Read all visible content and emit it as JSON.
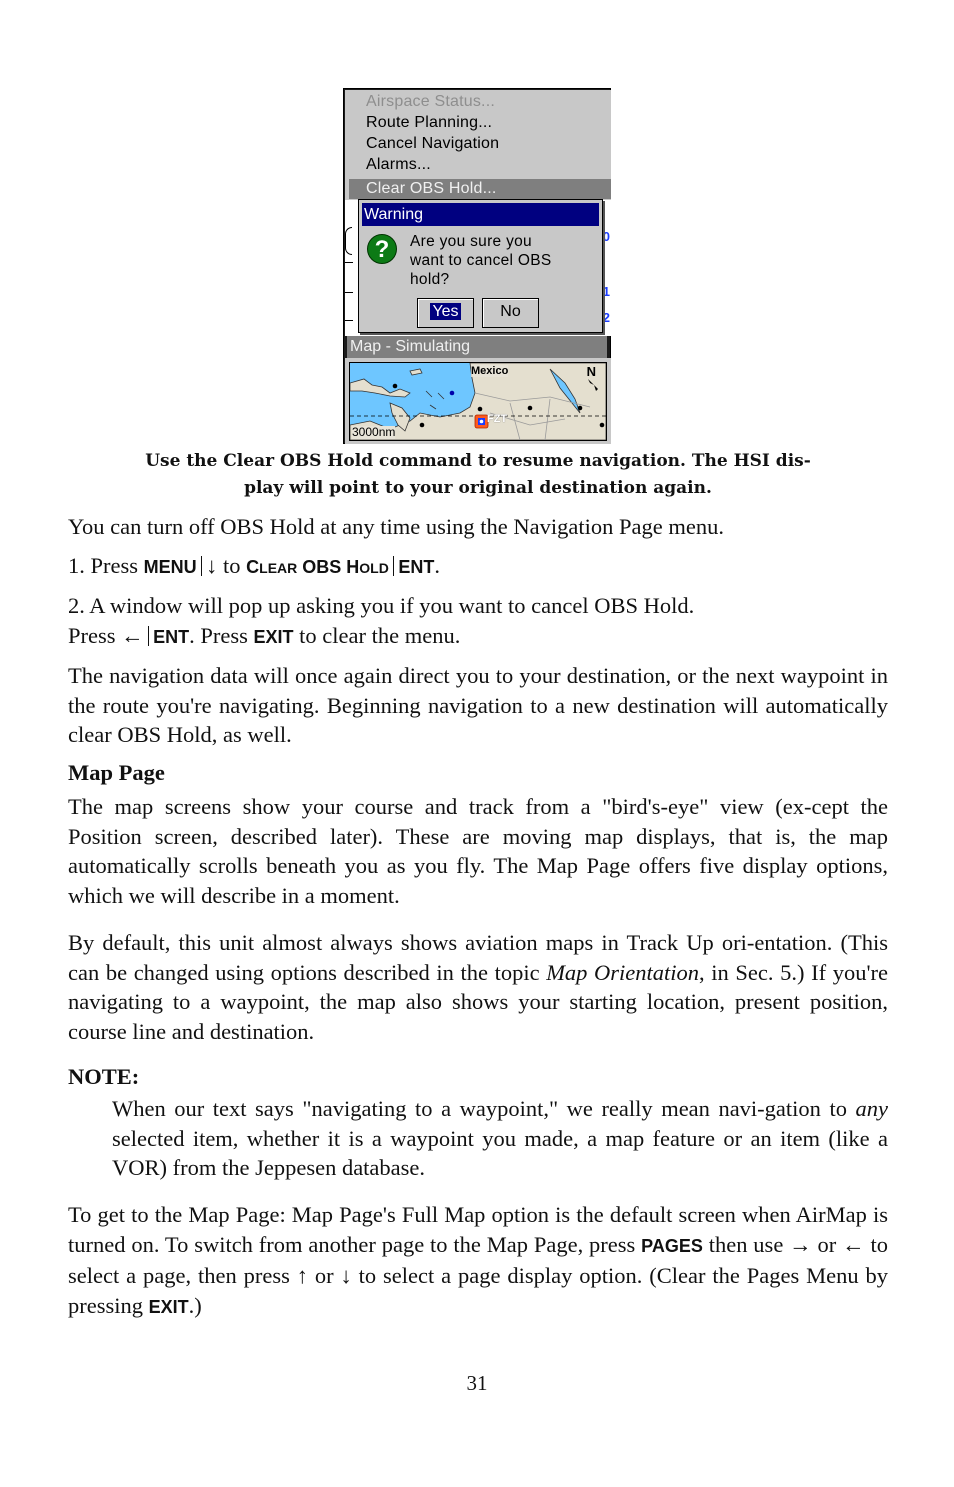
{
  "device": {
    "menu_items": [
      {
        "label": "Airspace Status...",
        "state": "disabled"
      },
      {
        "label": "Route Planning...",
        "state": "normal"
      },
      {
        "label": "Cancel Navigation",
        "state": "normal"
      },
      {
        "label": "Alarms...",
        "state": "normal"
      },
      {
        "label": "Clear OBS Hold...",
        "state": "highlighted"
      }
    ],
    "hsi_numbers": [
      "0",
      "1",
      "2"
    ],
    "warning": {
      "title": "Warning",
      "icon": "question-icon",
      "icon_glyph": "?",
      "message": "Are you sure you\nwant to cancel OBS\nhold?",
      "yes_label": "Yes",
      "no_label": "No"
    },
    "map": {
      "title": "Map - Simulating",
      "region_label": "Mexico",
      "north_label": "N",
      "waypoint_label": "FZT",
      "scale_label": "3000nm",
      "colors": {
        "water": "#6ec6ff",
        "land": "#e4dfcf",
        "highlight": "#000080",
        "waypoint": "#ff5a1f"
      }
    }
  },
  "caption": {
    "line1": "Use the Clear OBS Hold command to resume navigation. The HSI dis-",
    "line2": "play will point to your original destination again."
  },
  "intro": "You can turn off OBS Hold at any time using the Navigation Page menu.",
  "step1": {
    "prefix": "1. Press ",
    "key1": "MENU",
    "arrow": "↓",
    "mid": " to ",
    "command_c": "C",
    "command_lear": "LEAR",
    "command_obs": " OBS ",
    "command_h": "H",
    "command_old": "OLD",
    "key2": "ENT",
    "suffix": "."
  },
  "step2": {
    "line1": "2. A window will pop up asking you if you want to cancel OBS Hold.",
    "press1": "Press ",
    "arrow": "←",
    "key1": "ENT",
    "mid": ". Press ",
    "key2": "EXIT",
    "suffix": " to clear the menu."
  },
  "para_resume": "The navigation data will once again direct you to your destination, or the next waypoint in the route you're navigating. Beginning navigation to a new destination will automatically clear OBS Hold, as well.",
  "map_page": {
    "heading": "Map Page",
    "para1": "The map screens show your course and track from a \"bird's-eye\" view (ex-cept the Position screen, described later). These are moving map displays, that is, the map automatically scrolls beneath you as you fly. The Map Page offers five display options, which we will describe in a moment.",
    "para2_a": "By default, this unit almost always shows aviation maps in Track Up ori-entation. (This can be changed using options described in the topic ",
    "para2_italic": "Map Orientation",
    "para2_b": ", in Sec. 5.) If you're navigating to a waypoint, the map also shows your starting location, present position, course line and destination."
  },
  "note": {
    "heading": "NOTE:",
    "text_a": "When our text says \"navigating to a waypoint,\" we really mean navi-gation to ",
    "text_italic": "any",
    "text_b": " selected item, whether it is a waypoint you made, a map feature or an item (like a VOR) from the Jeppesen database."
  },
  "get_to_map": {
    "text_a": "To get to the Map Page: Map Page's Full Map option is the default screen when AirMap is turned on. To switch from another page to the Map Page, press ",
    "key_pages": "PAGES",
    "text_b": " then use ",
    "arrow_right": "→",
    "or1": " or ",
    "arrow_left": "←",
    "text_c": " to select a page, then press ",
    "arrow_up": "↑",
    "or2": " or ",
    "arrow_down": "↓",
    "text_d": " to select a page display option. (Clear the Pages Menu by pressing ",
    "key_exit": "EXIT",
    "text_e": ".)"
  },
  "page_number": "31"
}
